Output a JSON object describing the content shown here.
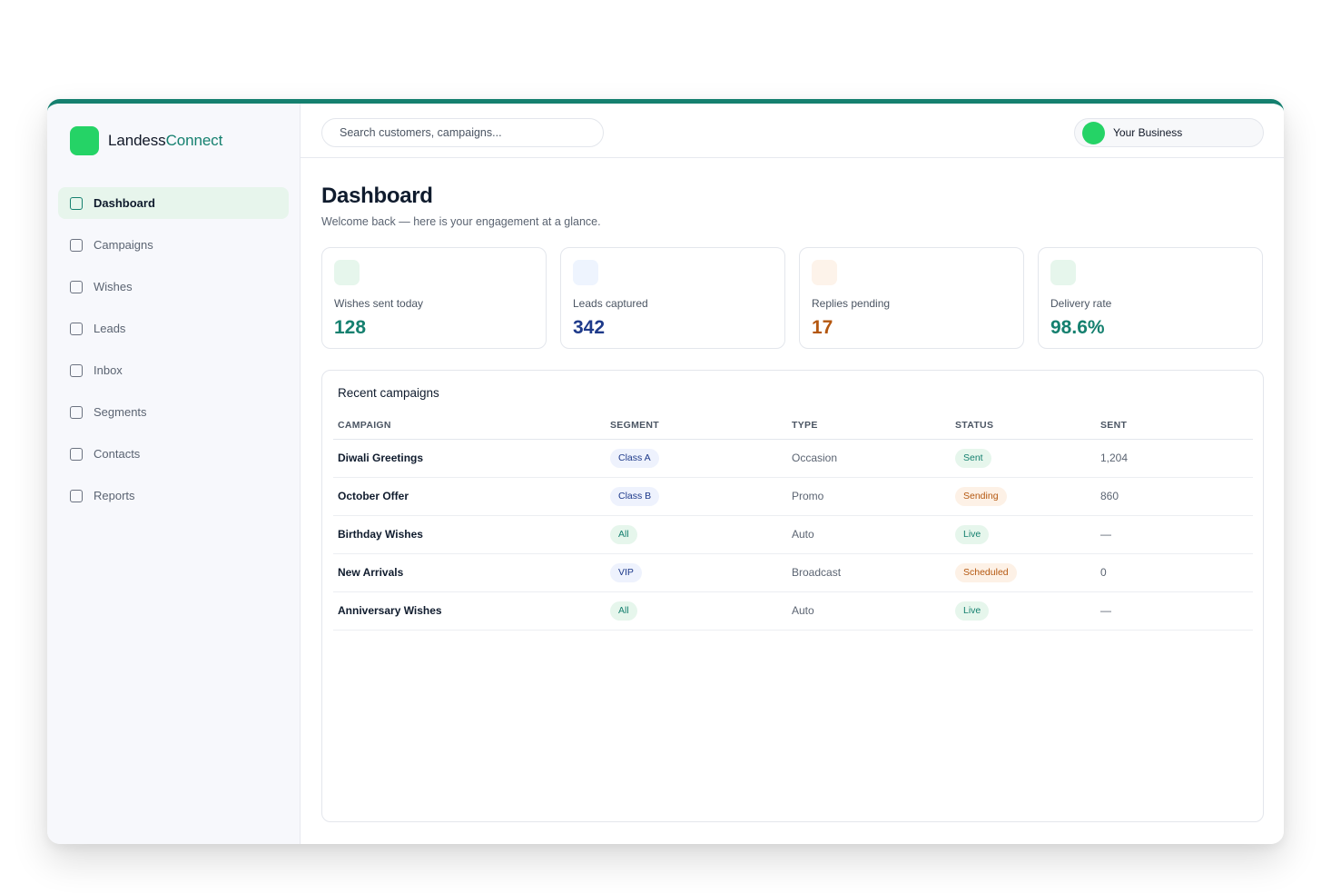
{
  "brand": {
    "name_part1": "Landess",
    "name_part2": "Connect"
  },
  "sidebar": {
    "items": [
      {
        "label": "Dashboard",
        "active": true
      },
      {
        "label": "Campaigns"
      },
      {
        "label": "Wishes"
      },
      {
        "label": "Leads"
      },
      {
        "label": "Inbox"
      },
      {
        "label": "Segments"
      },
      {
        "label": "Contacts"
      },
      {
        "label": "Reports"
      }
    ]
  },
  "topbar": {
    "search_placeholder": "Search customers, campaigns...",
    "account_name": "Your Business"
  },
  "page": {
    "title": "Dashboard",
    "subtitle": "Welcome back — here is your engagement at a glance."
  },
  "stats": [
    {
      "label": "Wishes sent today",
      "value": "128",
      "color": "#15806f",
      "icon_bg": "#e6f6ec"
    },
    {
      "label": "Leads captured",
      "value": "342",
      "color": "#1e3a8a",
      "icon_bg": "#eef4fe"
    },
    {
      "label": "Replies pending",
      "value": "17",
      "color": "#b4570f",
      "icon_bg": "#fdf3ea"
    },
    {
      "label": "Delivery rate",
      "value": "98.6%",
      "color": "#15806f",
      "icon_bg": "#e6f6ec"
    }
  ],
  "campaigns": {
    "title": "Recent campaigns",
    "columns": [
      "CAMPAIGN",
      "SEGMENT",
      "TYPE",
      "STATUS",
      "SENT"
    ],
    "rows": [
      {
        "campaign": "Diwali Greetings",
        "segment": "Class A",
        "type": "Occasion",
        "status": "Sent",
        "sent": "1,204"
      },
      {
        "campaign": "October Offer",
        "segment": "Class B",
        "type": "Promo",
        "status": "Sending",
        "sent": "860"
      },
      {
        "campaign": "Birthday Wishes",
        "segment": "All",
        "type": "Auto",
        "status": "Live",
        "sent": "—"
      },
      {
        "campaign": "New Arrivals",
        "segment": "VIP",
        "type": "Broadcast",
        "status": "Scheduled",
        "sent": "0"
      },
      {
        "campaign": "Anniversary Wishes",
        "segment": "All",
        "type": "Auto",
        "status": "Live",
        "sent": "—"
      }
    ]
  },
  "colors": {
    "accent": "#15806f",
    "brand_green": "#25d366",
    "pill_blue": "#1e3a8a",
    "pill_green": "#15806f",
    "pill_orange": "#b4570f"
  }
}
